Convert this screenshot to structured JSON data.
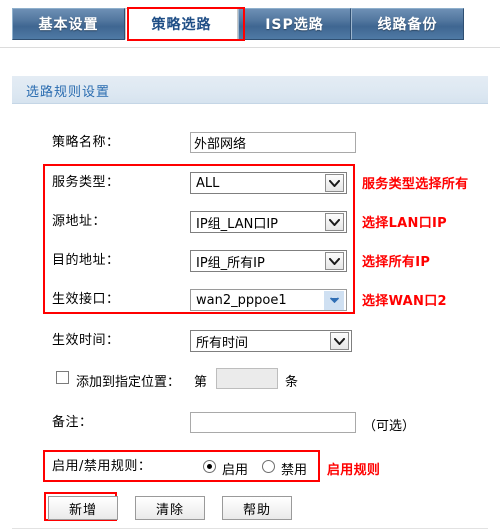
{
  "tabs": [
    {
      "label": "基本设置",
      "active": false
    },
    {
      "label": "策略选路",
      "active": true
    },
    {
      "label": "ISP选路",
      "active": false
    },
    {
      "label": "线路备份",
      "active": false
    }
  ],
  "section": {
    "title": "选路规则设置"
  },
  "form": {
    "policy_name": {
      "label": "策略名称：",
      "value": "外部网络",
      "placeholder": ""
    },
    "service_type": {
      "label": "服务类型：",
      "value": "ALL"
    },
    "source_address": {
      "label": "源地址：",
      "value": "IP组_LAN口IP"
    },
    "dest_address": {
      "label": "目的地址：",
      "value": "IP组_所有IP"
    },
    "effective_interface": {
      "label": "生效接口：",
      "value": "wan2_pppoe1"
    },
    "effective_time": {
      "label": "生效时间：",
      "value": "所有时间"
    },
    "add_position": {
      "checkbox_label": "添加到指定位置：",
      "prefix": "第",
      "value": "",
      "suffix": "条",
      "checked": false
    },
    "remark": {
      "label": "备注：",
      "value": "",
      "hint": "（可选）"
    },
    "enable_rule": {
      "label": "启用/禁用规则：",
      "options": [
        {
          "label": "启用",
          "selected": true
        },
        {
          "label": "禁用",
          "selected": false
        }
      ]
    }
  },
  "buttons": {
    "add": "新增",
    "clear": "清除",
    "help": "帮助"
  },
  "annotations": {
    "tab_note": "",
    "service_type": "服务类型选择所有",
    "source_address": "选择LAN口IP",
    "dest_address": "选择所有IP",
    "effective_interface": "选择WAN口2",
    "enable_rule": "启用规则"
  },
  "colors": {
    "annotation_red": "#ff0000",
    "tab_active_text": "#1f4e86",
    "tab_blue": "#3f6691",
    "section_title": "#2a6cb0"
  }
}
